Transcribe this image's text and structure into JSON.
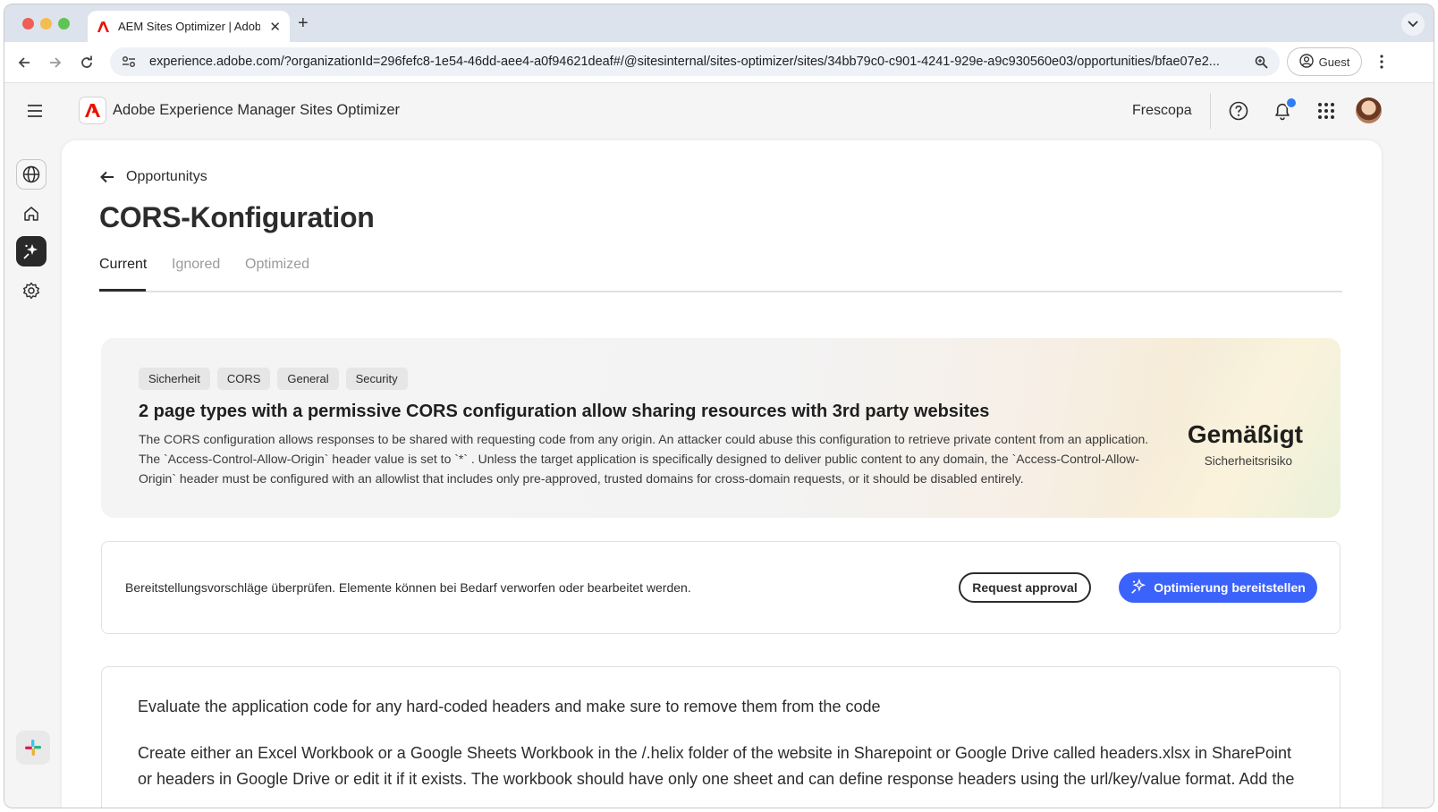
{
  "browser": {
    "tab_title": "AEM Sites Optimizer | Adobe",
    "url": "experience.adobe.com/?organizationId=296fefc8-1e54-46dd-aee4-a0f94621deaf#/@sitesinternal/sites-optimizer/sites/34bb79c0-c901-4241-929e-a9c930560e03/opportunities/bfae07e2...",
    "profile_label": "Guest"
  },
  "app": {
    "product_name": "Adobe Experience Manager Sites Optimizer",
    "org_name": "Frescopa",
    "brand_color": "#eb1000",
    "accent_color": "#3b63fb"
  },
  "page": {
    "back_label": "Opportunitys",
    "title": "CORS-Konfiguration",
    "tabs": [
      {
        "label": "Current",
        "active": true
      },
      {
        "label": "Ignored",
        "active": false
      },
      {
        "label": "Optimized",
        "active": false
      }
    ]
  },
  "opportunity": {
    "tags": [
      "Sicherheit",
      "CORS",
      "General",
      "Security"
    ],
    "headline": "2 page types with a permissive CORS configuration allow sharing resources with 3rd party websites",
    "description": "The CORS configuration allows responses to be shared with requesting code from any origin. An attacker could abuse this configuration to retrieve private content from an application. The `Access-Control-Allow-Origin` header value is set to `*` . Unless the target application is specifically designed to deliver public content to any domain, the `Access-Control-Allow-Origin` header must be configured with an allowlist that includes only pre-approved, trusted domains for cross-domain requests, or it should be disabled entirely.",
    "risk_level": "Gemäßigt",
    "risk_label": "Sicherheitsrisiko"
  },
  "actions": {
    "instruction": "Bereitstellungsvorschläge überprüfen. Elemente können bei Bedarf verworfen oder bearbeitet werden.",
    "request_approval": "Request approval",
    "deploy": "Optimierung bereitstellen"
  },
  "steps": {
    "step1": "Evaluate the application code for any hard-coded headers and make sure to remove them from the code",
    "step2": "Create either an Excel Workbook or a Google Sheets Workbook in the /.helix folder of the website in Sharepoint or Google Drive called headers.xlsx in SharePoint or headers in Google Drive or edit it if it exists. The workbook should have only one sheet and can define response headers using the url/key/value format. Add the"
  },
  "icons": {
    "rail": [
      "globe-icon",
      "home-icon",
      "opportunities-icon",
      "settings-icon",
      "slack-icon"
    ],
    "header": [
      "menu-icon",
      "adobe-logo-icon",
      "help-icon",
      "bell-icon",
      "apps-grid-icon"
    ]
  }
}
